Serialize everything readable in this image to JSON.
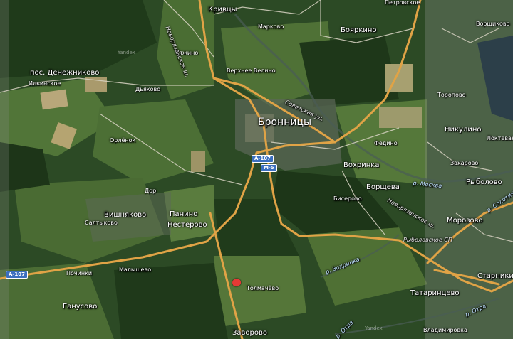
{
  "map": {
    "places": {
      "krivtsy": "Кривцы",
      "petrovskoe": "Петровское",
      "boyarkino": "Бояркино",
      "vorshchikovo": "Ворщиково",
      "markovo": "Марково",
      "tyazhino": "Тяжино",
      "denezhnikovo": "пос. Денежниково",
      "ilyinskoe": "Ильинское",
      "verkhnee_velino": "Верхнее Велино",
      "dyakovo": "Дьяково",
      "bronnitsy": "Бронницы",
      "toropovo": "Торопово",
      "nikulino": "Никулино",
      "loktevaya": "Локтевая",
      "fedino": "Федино",
      "orlenok": "Орлёнок",
      "zakharovo": "Захарово",
      "vokhrinka": "Вохринка",
      "borsheva": "Борщева",
      "rybolovo": "Рыболово",
      "dor": "Дор",
      "biserovo": "Бисерово",
      "vishnyakovo": "Вишняково",
      "panino": "Панино",
      "saltykovo": "Салтыково",
      "nesterovo": "Нестерово",
      "morozovo": "Морозово",
      "pochinki": "Починки",
      "malyshevo": "Малышево",
      "tolmachevo": "Толмачёво",
      "starniki": "Старники",
      "tatarintsevo": "Татаринцево",
      "ganusovo": "Ганусово",
      "zavorovo": "Заворово",
      "vladimirovka": "Владимировка"
    },
    "roads": {
      "novoryazanskoe_top": "Новорязанское ш.",
      "sovetskaya": "Советская ул.",
      "novoryazanskoe_bottom": "Новорязанское ш.",
      "rybolovskoe_sp": "Рыболовское СП"
    },
    "rivers": {
      "moskva": "р. Москва",
      "solotinka": "р. Солотинка",
      "vokhrinka": "р. Вохринка",
      "otra_right": "р. Отра",
      "otra_bottom": "р. Отра"
    },
    "shields": {
      "a107_center": "A-107",
      "m5": "M-5",
      "a107_left": "A-107"
    },
    "watermarks": {
      "yandex_1": "Yandex",
      "yandex_2": "Yandex"
    },
    "colors": {
      "forest_dark": "#223c1c",
      "field": "#4d7034",
      "road_major": "#e0a346",
      "road_minor": "#d9d4c4",
      "marker": "#e53935",
      "river_label": "#bfe0ff",
      "shield": "#3c6fbf"
    },
    "marker_icon": "location-pin-icon"
  }
}
